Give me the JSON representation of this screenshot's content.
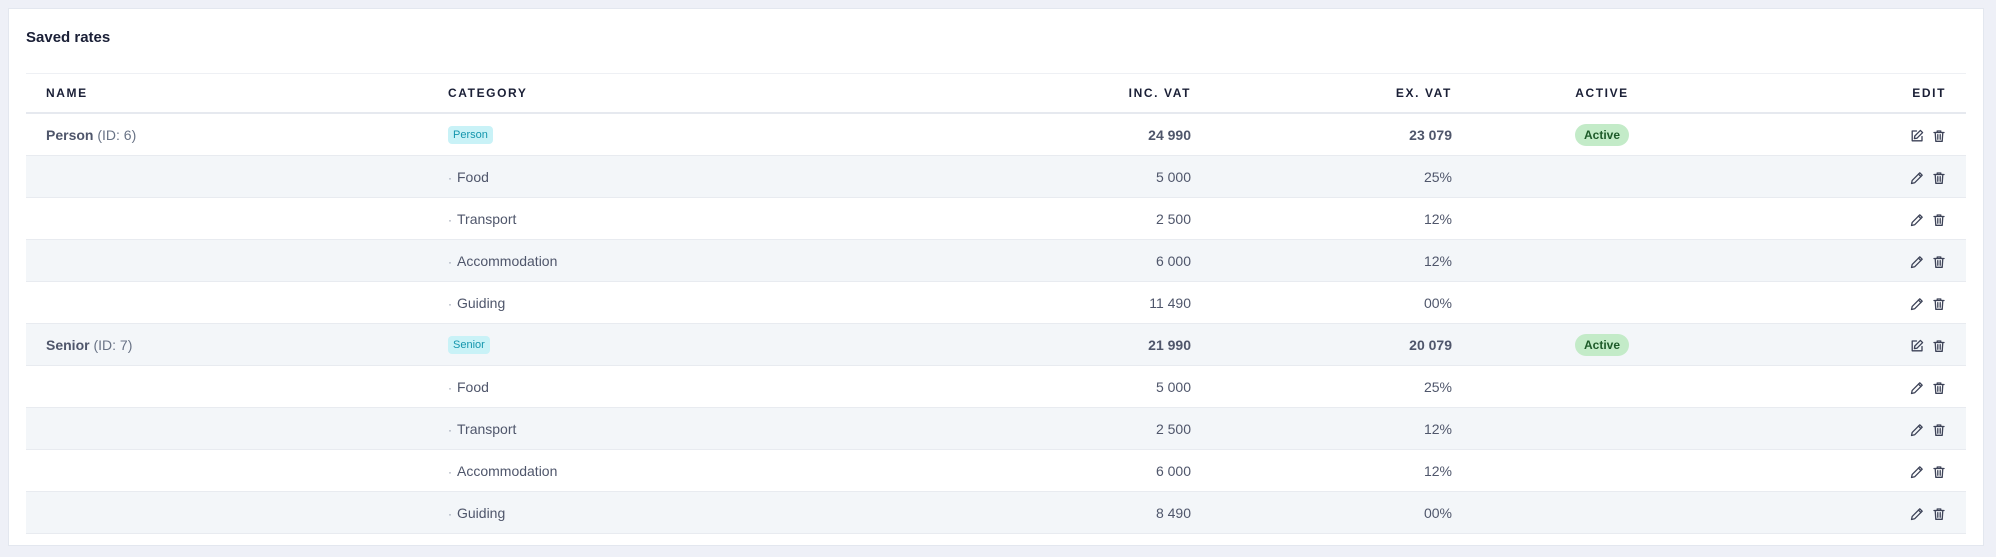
{
  "card": {
    "title": "Saved rates"
  },
  "table": {
    "headers": {
      "name": "NAME",
      "category": "CATEGORY",
      "inc_vat": "INC. VAT",
      "ex_vat": "EX. VAT",
      "active": "ACTIVE",
      "edit": "EDIT"
    },
    "groups": [
      {
        "name": "Person",
        "id_text": "(ID: 6)",
        "category": "Person",
        "inc_vat": "24 990",
        "ex_vat": "23 079",
        "status": "Active",
        "items": [
          {
            "label": "Food",
            "inc_vat": "5 000",
            "vat": "25%"
          },
          {
            "label": "Transport",
            "inc_vat": "2 500",
            "vat": "12%"
          },
          {
            "label": "Accommodation",
            "inc_vat": "6 000",
            "vat": "12%"
          },
          {
            "label": "Guiding",
            "inc_vat": "11 490",
            "vat": "00%"
          }
        ]
      },
      {
        "name": "Senior",
        "id_text": "(ID: 7)",
        "category": "Senior",
        "inc_vat": "21 990",
        "ex_vat": "20 079",
        "status": "Active",
        "items": [
          {
            "label": "Food",
            "inc_vat": "5 000",
            "vat": "25%"
          },
          {
            "label": "Transport",
            "inc_vat": "2 500",
            "vat": "12%"
          },
          {
            "label": "Accommodation",
            "inc_vat": "6 000",
            "vat": "12%"
          },
          {
            "label": "Guiding",
            "inc_vat": "8 490",
            "vat": "00%"
          }
        ]
      }
    ]
  },
  "icons": {
    "group_edit": "edit-square-icon",
    "item_edit": "pencil-icon",
    "delete": "trash-icon",
    "bullet": "·"
  },
  "colors": {
    "category_bg": "#c9f2f7",
    "category_text": "#1596ad",
    "status_bg": "#c3ebc8",
    "status_text": "#1e5b2a",
    "shade_row": "#f3f6f9"
  }
}
